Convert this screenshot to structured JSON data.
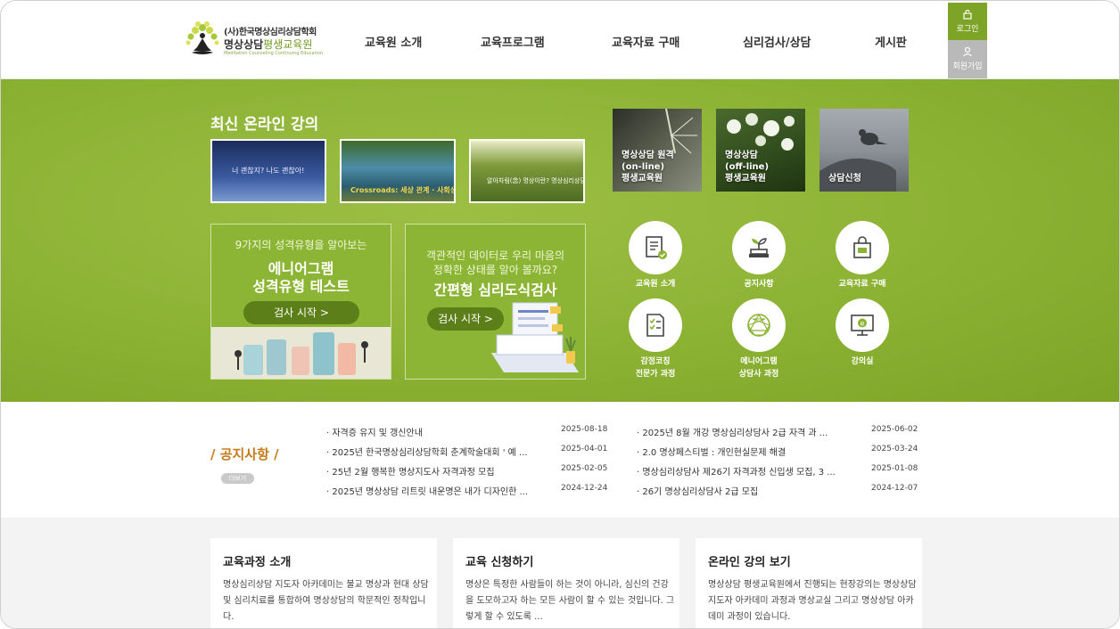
{
  "header": {
    "logo_line1": "(사)한국명상심리상담학회",
    "logo_line2a": "명상상담",
    "logo_line2b": "평생교육원",
    "logo_line3": "Meditation Counseling Continuing Education",
    "nav": [
      "교육원 소개",
      "교육프로그램",
      "교육자료 구매",
      "심리검사/상담",
      "게시판"
    ],
    "login": "로그인",
    "join": "회원가입"
  },
  "lectures": {
    "title": "최신 온라인 강의",
    "thumbs": [
      {
        "caption": "너 괜찮지? 나도 괜찮아!"
      },
      {
        "caption": "Crossroads: 세상 관계 · 사회성"
      },
      {
        "caption": "알아차림(念) 명상이란? 명상심리상담2"
      }
    ]
  },
  "promos": {
    "enneagram": {
      "line1": "9가지의 성격유형을 알아보는",
      "line2": "에니어그램",
      "line3": "성격유형 테스트",
      "button": "검사 시작 >"
    },
    "simple": {
      "line1": "객관적인 데이터로 우리 마음의",
      "line2": "정확한 상태를 알아 볼까요?",
      "line3": "간편형 심리도식검사",
      "button": "검사 시작 >"
    }
  },
  "tiles": [
    {
      "label": "명상상담 원격\n(on-line)\n평생교육원"
    },
    {
      "label": "명상상담\n(off-line)\n평생교육원"
    },
    {
      "label": "상담신청"
    }
  ],
  "quick_links": [
    {
      "label": "교육원 소개",
      "icon": "document-check-icon"
    },
    {
      "label": "공지사항",
      "icon": "sprout-icon"
    },
    {
      "label": "교육자료 구매",
      "icon": "shopping-bag-icon"
    },
    {
      "label": "감정코칭\n전문가 과정",
      "icon": "checklist-icon"
    },
    {
      "label": "에니어그램\n상담사 과정",
      "icon": "enneagram-icon"
    },
    {
      "label": "강의실",
      "icon": "e-learning-icon"
    }
  ],
  "notices": {
    "title": "/ 공지사항 /",
    "more": "더보기",
    "left": [
      {
        "text": "· 자격증 유지 및 갱신안내",
        "date": "2025-08-18"
      },
      {
        "text": "· 2025년 한국명상심리상담학회 춘계학술대회 ' 예 ...",
        "date": "2025-04-01"
      },
      {
        "text": "· 25년 2월 행복한 명상지도사 자격과정 모집",
        "date": "2025-02-05"
      },
      {
        "text": "· 2025년 명상상담 리트릿 내운명은 내가 디자인한 ...",
        "date": "2024-12-24"
      }
    ],
    "right": [
      {
        "text": "· 2025년 8월 개강 명상심리상담사 2급 자격 과 ...",
        "date": "2025-06-02"
      },
      {
        "text": "· 2.0 명상페스티벌 : 개인현실문제 해결",
        "date": "2025-03-24"
      },
      {
        "text": "· 명상심리상담사 제26기 자격과정 신입생 모집, 3 ...",
        "date": "2025-01-08"
      },
      {
        "text": "· 26기 명상심리상담사 2급 모집",
        "date": "2024-12-07"
      }
    ]
  },
  "cards": [
    {
      "title": "교육과정 소개",
      "body": "명상심리상담 지도자 아카데미는 불교 명상과 현대 상담 및 심리치료를 통합하여 명상상담의 학문적인 정착입니다."
    },
    {
      "title": "교육 신청하기",
      "body": "명상은 특정한 사람들이 하는 것이 아니라, 심신의 건강을 도모하고자 하는 모든 사람이 할 수 있는 것입니다. 그렇게 할 수 있도록 ..."
    },
    {
      "title": "온라인 강의 보기",
      "body": "명상상담 평생교육원에서 진행되는 현장강의는 명상상담 지도자 아카데미 과정과 명상교실 그리고 명상상담 아카데미 과정이 있습니다."
    }
  ],
  "colors": {
    "brand_green": "#8cb234",
    "notice_orange": "#c57a1b",
    "login_green": "#7da327"
  }
}
